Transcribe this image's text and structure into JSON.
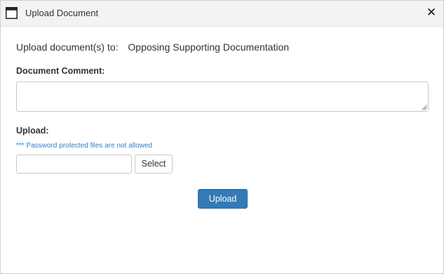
{
  "dialog": {
    "title": "Upload Document",
    "window_icon": "window-icon",
    "close_symbol": "✕"
  },
  "destination": {
    "label": "Upload document(s) to:",
    "value": "Opposing Supporting Documentation"
  },
  "comment": {
    "label": "Document Comment:",
    "value": ""
  },
  "upload": {
    "label": "Upload:",
    "note": "*** Password protected files are not allowed",
    "file_value": "",
    "select_label": "Select",
    "submit_label": "Upload"
  },
  "colors": {
    "accent": "#337ab7",
    "note": "#2f7fd1",
    "titlebar": "#f3f3f3"
  }
}
